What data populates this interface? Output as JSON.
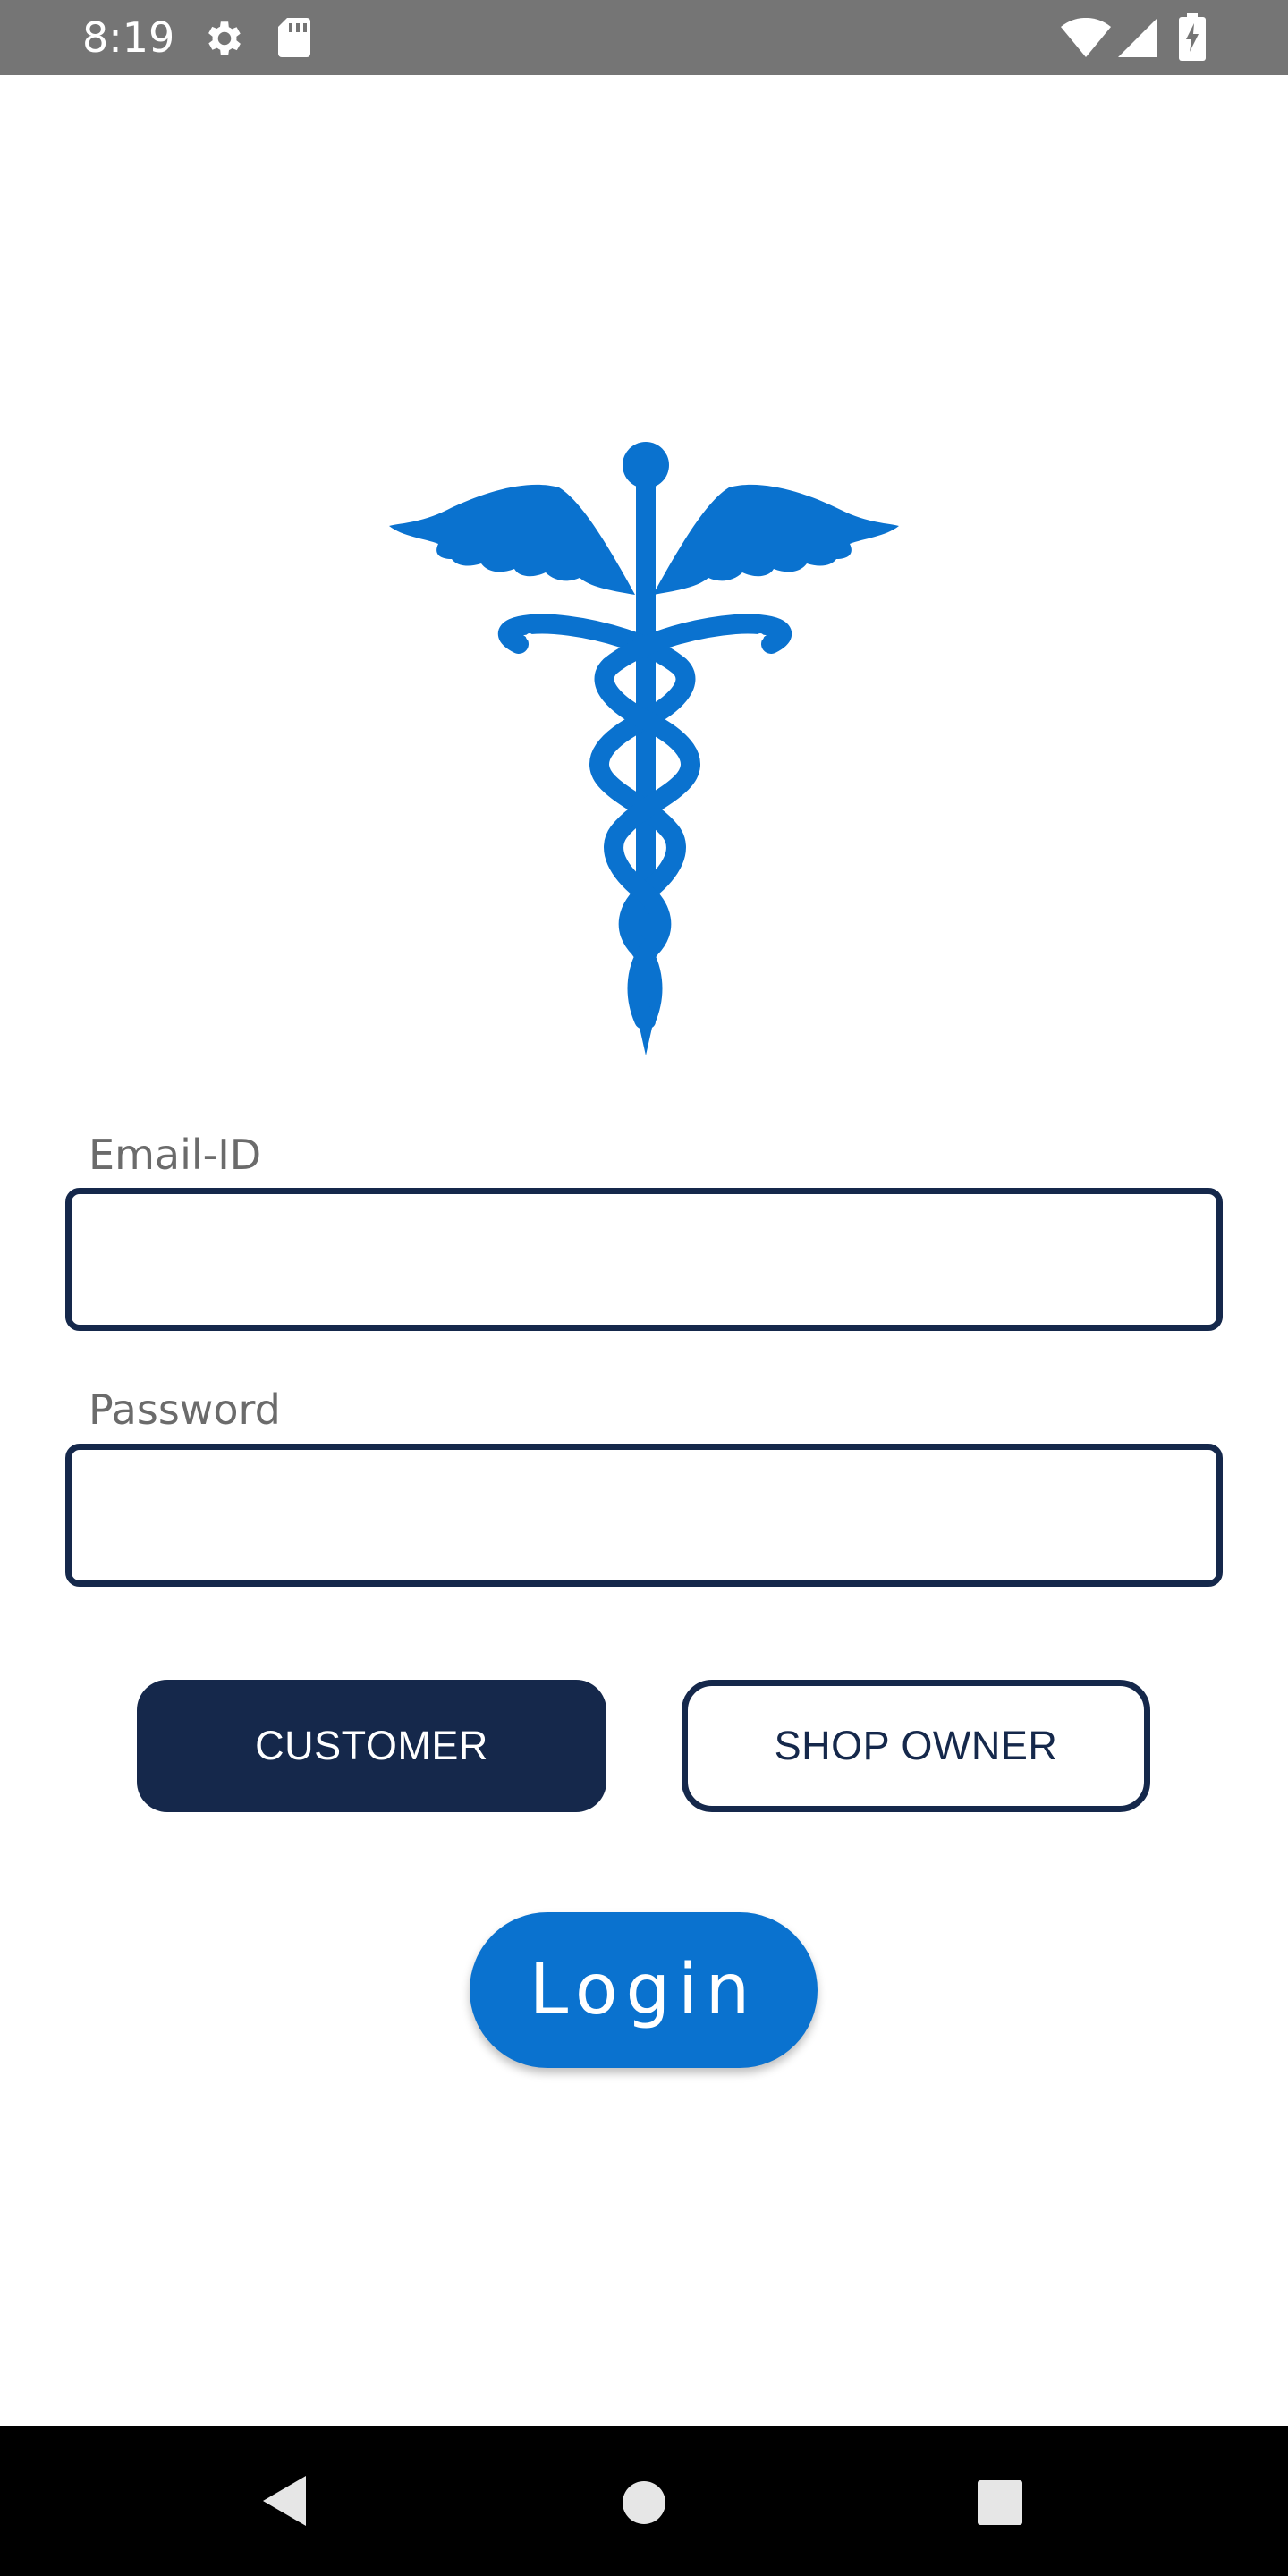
{
  "status_bar": {
    "time": "8:19",
    "icons": [
      "gear-icon",
      "sd-card-icon",
      "wifi-icon",
      "signal-icon",
      "battery-charging-icon"
    ]
  },
  "logo": {
    "icon": "caduceus-icon",
    "color": "#0a72cf"
  },
  "form": {
    "email": {
      "label": "Email-ID",
      "value": "",
      "placeholder": ""
    },
    "password": {
      "label": "Password",
      "value": "",
      "placeholder": ""
    }
  },
  "roles": {
    "customer_label": "CUSTOMER",
    "shop_owner_label": "SHOP OWNER",
    "selected": "CUSTOMER"
  },
  "login_label": "Login",
  "nav": {
    "icons": [
      "back-icon",
      "home-icon",
      "recents-icon"
    ]
  },
  "colors": {
    "primary_dark": "#15284b",
    "accent": "#0a72cf",
    "status_bar": "#757575"
  }
}
